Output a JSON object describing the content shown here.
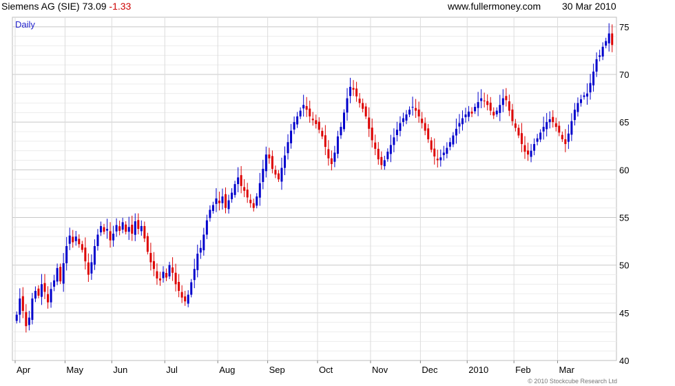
{
  "header": {
    "instrument": "Siemens AG (SIE)",
    "last": "73.09",
    "change": "-1.33",
    "site": "www.fullermoney.com",
    "date": "30 Mar 2010"
  },
  "footer": {
    "copyright": "© 2010 Stockcube Research Ltd"
  },
  "chart_data": {
    "type": "candlestick",
    "period_label": "Daily",
    "ylim": [
      40,
      76
    ],
    "y_ticks": [
      40,
      45,
      50,
      55,
      60,
      65,
      70,
      75
    ],
    "x_tick_labels": [
      "Apr",
      "May",
      "Jun",
      "Jul",
      "Aug",
      "Sep",
      "Oct",
      "Nov",
      "Dec",
      "2010",
      "Feb",
      "Mar"
    ],
    "grid": true,
    "colors": {
      "up": "#0000cc",
      "down": "#dd0000",
      "grid": "#dcdcdc",
      "text": "#000000"
    },
    "closes": [
      44.8,
      46.5,
      45.2,
      43.6,
      44.5,
      46.5,
      47.3,
      46.8,
      48.0,
      47.2,
      46.1,
      47.5,
      48.4,
      49.7,
      48.3,
      50.2,
      52.0,
      53.1,
      52.4,
      53.0,
      52.2,
      51.6,
      50.4,
      49.0,
      50.3,
      52.0,
      53.2,
      54.1,
      53.5,
      53.8,
      52.6,
      53.3,
      54.2,
      53.6,
      54.5,
      53.5,
      54.0,
      53.3,
      54.6,
      53.8,
      54.1,
      52.8,
      51.4,
      50.3,
      49.6,
      48.6,
      48.4,
      49.3,
      48.7,
      50.0,
      49.2,
      48.0,
      47.3,
      46.6,
      46.2,
      46.9,
      48.2,
      49.6,
      51.2,
      51.8,
      53.2,
      54.7,
      55.8,
      56.3,
      57.0,
      56.5,
      57.2,
      56.0,
      56.8,
      57.6,
      58.5,
      59.2,
      58.3,
      57.8,
      57.1,
      56.5,
      56.0,
      57.2,
      58.6,
      60.1,
      61.6,
      61.2,
      60.1,
      59.5,
      59.0,
      60.2,
      61.5,
      62.9,
      64.1,
      65.0,
      65.6,
      66.2,
      66.8,
      66.3,
      65.6,
      65.2,
      64.8,
      64.2,
      63.5,
      62.4,
      61.2,
      60.6,
      61.8,
      63.5,
      64.5,
      66.0,
      67.5,
      68.7,
      68.4,
      67.7,
      67.0,
      66.4,
      65.6,
      64.3,
      63.1,
      62.2,
      61.1,
      60.5,
      61.0,
      61.9,
      62.6,
      63.4,
      64.2,
      64.9,
      65.4,
      65.8,
      66.3,
      66.6,
      66.2,
      65.6,
      64.9,
      64.1,
      63.2,
      62.1,
      61.4,
      61.0,
      61.3,
      61.8,
      62.3,
      62.9,
      63.6,
      64.3,
      64.9,
      65.4,
      65.8,
      66.1,
      65.9,
      66.6,
      67.1,
      67.5,
      67.2,
      66.8,
      66.2,
      65.7,
      66.2,
      66.8,
      67.5,
      67.3,
      66.2,
      65.1,
      64.4,
      63.6,
      62.7,
      61.9,
      61.6,
      62.0,
      62.7,
      63.3,
      63.9,
      64.5,
      65.0,
      65.3,
      65.0,
      64.5,
      63.9,
      63.2,
      62.7,
      63.8,
      65.1,
      66.3,
      67.0,
      67.4,
      67.8,
      68.0,
      69.1,
      70.3,
      71.6,
      72.0,
      72.9,
      73.5,
      74.3,
      73.09
    ]
  }
}
